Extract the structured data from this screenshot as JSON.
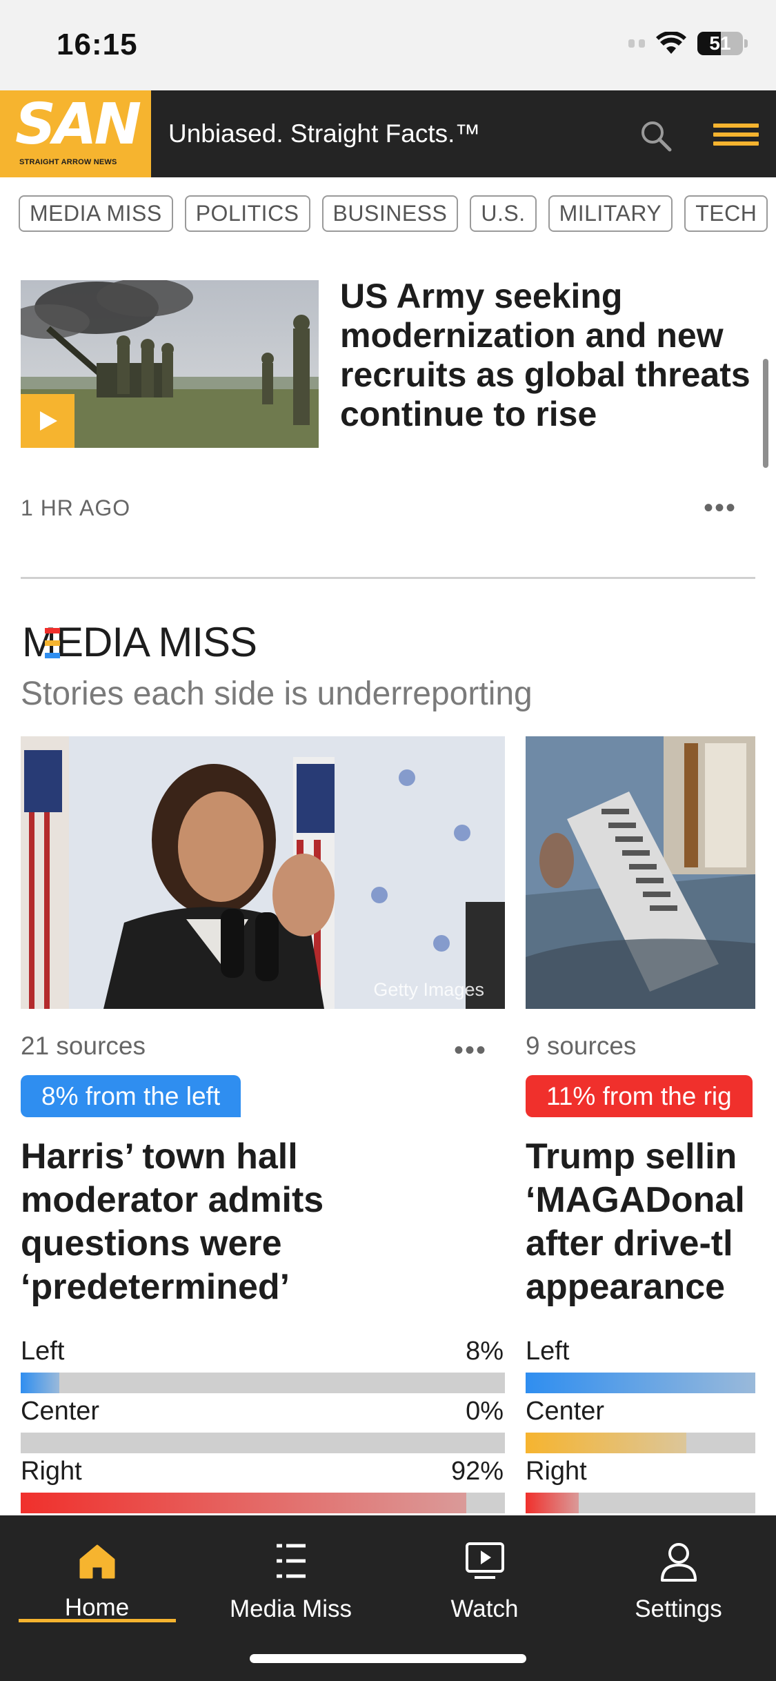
{
  "status_bar": {
    "time": "16:15",
    "battery": "51",
    "battery_level": 0.51
  },
  "header": {
    "logo_text": "SAN",
    "logo_subtext": "STRAIGHT ARROW NEWS",
    "tagline": "Unbiased. Straight Facts.™"
  },
  "categories": [
    "MEDIA MISS",
    "POLITICS",
    "BUSINESS",
    "U.S.",
    "MILITARY",
    "TECH"
  ],
  "top_article": {
    "title": "US Army seeking modernization and new recruits as global threats continue to rise",
    "time": "1 HR AGO"
  },
  "media_miss": {
    "logo": "MEDIA MISS",
    "subtitle": "Stories each side is underreporting",
    "cards": [
      {
        "credit": "Getty Images",
        "sources": "21 sources",
        "badge": "8% from the left",
        "badge_color": "#2f8ef0",
        "title_lines": [
          "Harris’ town hall",
          "moderator admits",
          "questions were",
          "‘predetermined’"
        ],
        "bias": [
          {
            "label": "Left",
            "pct": "8%",
            "value": 8,
            "color": "#2f8ef0"
          },
          {
            "label": "Center",
            "pct": "0%",
            "value": 0,
            "color": "#f6b42f"
          },
          {
            "label": "Right",
            "pct": "92%",
            "value": 92,
            "color": "#f0302c"
          }
        ]
      },
      {
        "credit": "",
        "sources": "9 sources",
        "badge": "11% from the rig",
        "badge_color": "#f0302c",
        "title_lines": [
          "Trump sellin",
          "‘MAGADonal",
          "after drive-tl",
          "appearance"
        ],
        "bias": [
          {
            "label": "Left",
            "pct": "",
            "value": 100,
            "color": "#2f8ef0"
          },
          {
            "label": "Center",
            "pct": "",
            "value": 70,
            "color": "#f6b42f"
          },
          {
            "label": "Right",
            "pct": "",
            "value": 23,
            "color": "#f0302c"
          }
        ]
      }
    ]
  },
  "nav": {
    "items": [
      {
        "label": "Home",
        "icon": "home-icon",
        "active": true
      },
      {
        "label": "Media Miss",
        "icon": "list-icon",
        "active": false
      },
      {
        "label": "Watch",
        "icon": "play-icon",
        "active": false
      },
      {
        "label": "Settings",
        "icon": "user-icon",
        "active": false
      }
    ],
    "accent": "#f6b42f"
  }
}
